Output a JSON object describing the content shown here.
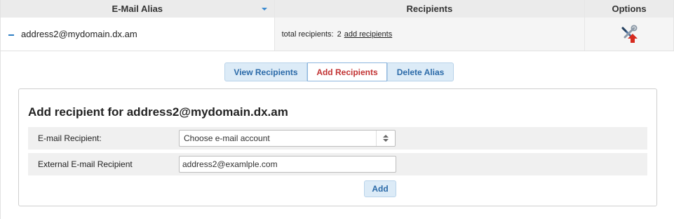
{
  "table": {
    "headers": {
      "alias": "E-Mail Alias",
      "recipients": "Recipients",
      "options": "Options"
    },
    "row": {
      "alias": "address2@mydomain.dx.am",
      "recipients_label": "total recipients:",
      "recipients_count": "2",
      "add_recipients_link": "add recipients",
      "options_icon": "settings-tools-icon"
    }
  },
  "tabs": {
    "view": "View Recipients",
    "add": "Add Recipients",
    "delete": "Delete Alias",
    "active": "add"
  },
  "form": {
    "title": "Add recipient for address2@mydomain.dx.am",
    "email_recipient_label": "E-mail Recipient:",
    "email_recipient_value": "Choose e-mail account",
    "external_label": "External E-mail Recipient",
    "external_value": "address2@examlple.com",
    "add_button": "Add"
  },
  "colors": {
    "accent": "#2b6aa8",
    "active_tab_text": "#c23333",
    "button_bg": "#dcebf7",
    "header_bg": "#ebebeb"
  }
}
